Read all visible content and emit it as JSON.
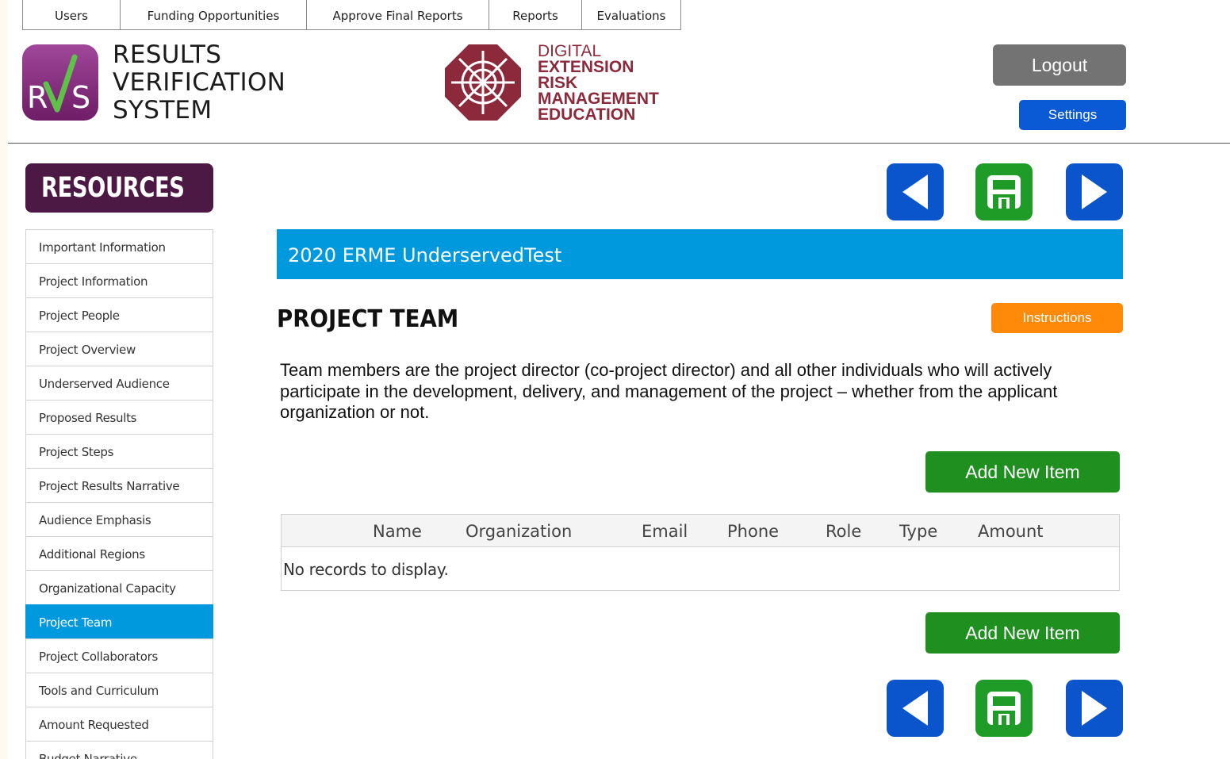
{
  "topnav": {
    "items": [
      "Users",
      "Funding Opportunities",
      "Approve Final Reports",
      "Reports",
      "Evaluations"
    ]
  },
  "branding": {
    "rvs_mark": "RVS",
    "rvs_lines": [
      "RESULTS",
      "VERIFICATION",
      "SYSTEM"
    ],
    "derme_lines": [
      "DIGITAL",
      "EXTENSION",
      "RISK",
      "MANAGEMENT",
      "EDUCATION"
    ]
  },
  "header": {
    "logout_label": "Logout",
    "settings_label": "Settings"
  },
  "resources": {
    "label": "RESOURCES"
  },
  "sidebar": {
    "items": [
      "Important Information",
      "Project Information",
      "Project People",
      "Project Overview",
      "Underserved Audience",
      "Proposed Results",
      "Project Steps",
      "Project Results Narrative",
      "Audience Emphasis",
      "Additional Regions",
      "Organizational Capacity",
      "Project Team",
      "Project Collaborators",
      "Tools and Curriculum",
      "Amount Requested",
      "Budget Narrative"
    ],
    "active_index": 11
  },
  "main": {
    "project_name": "2020 ERME UnderservedTest",
    "section_title": "PROJECT TEAM",
    "instructions_label": "Instructions",
    "description": "Team members are the project director (co-project director) and all other individuals who will actively participate in the development, delivery, and management of the project – whether from the applicant organization or not.",
    "add_label": "Add New Item",
    "grid": {
      "columns": [
        "Name",
        "Organization",
        "Email",
        "Phone",
        "Role",
        "Type",
        "Amount"
      ],
      "empty_message": "No records to display."
    }
  },
  "colors": {
    "accent_blue": "#0099dd",
    "nav_blue": "#0a55cc",
    "save_green": "#1f9c28",
    "add_green": "#1f8f1f",
    "instructions_orange": "#ff8a0a",
    "resources_purple": "#4b1943",
    "derme_maroon": "#8c2a3c"
  },
  "icons": {
    "prev": "triangle-left-icon",
    "save": "floppy-disk-icon",
    "next": "triangle-right-icon"
  }
}
